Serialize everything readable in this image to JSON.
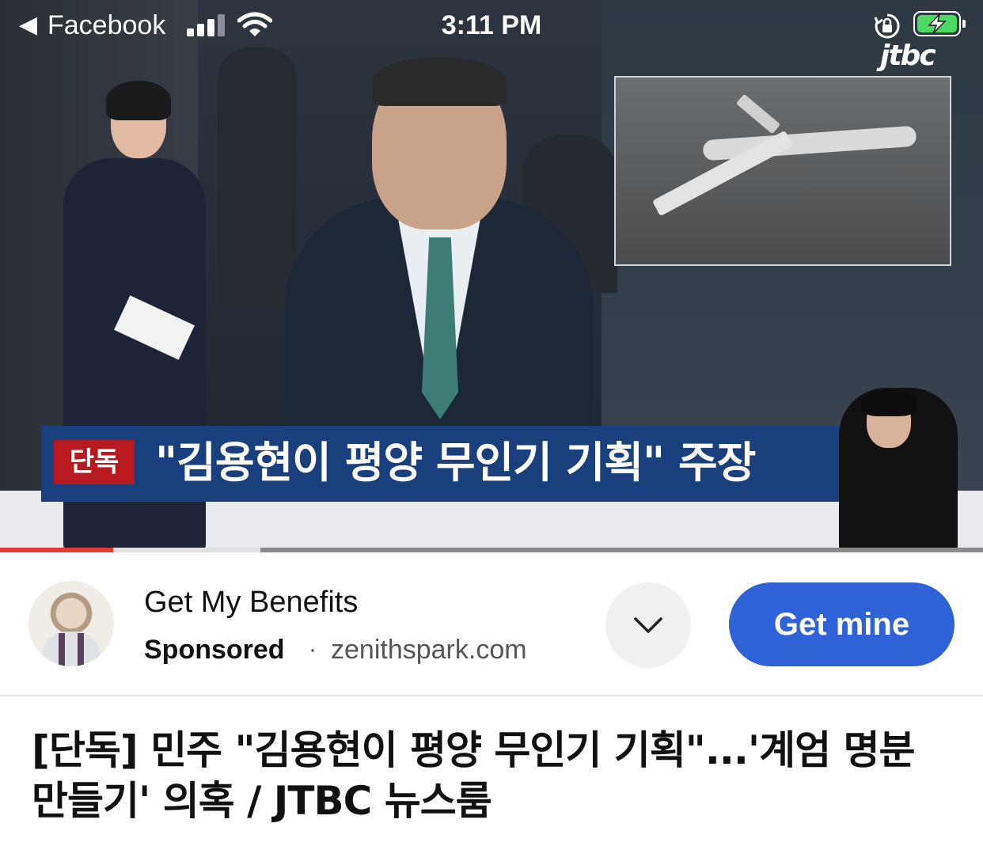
{
  "status_bar": {
    "back_label": "Facebook",
    "time": "3:11 PM",
    "battery_color": "#4cd964"
  },
  "video": {
    "channel_logo": "jtbc",
    "caption_badge": "단독",
    "caption_text": "\"김용현이 평양 무인기 기획\" 주장",
    "progress_played_fraction": 0.115,
    "progress_buffered_fraction": 0.265
  },
  "ad": {
    "advertiser_name": "Get My Benefits",
    "sponsored_label": "Sponsored",
    "separator": "·",
    "domain": "zenithspark.com",
    "cta_label": "Get mine",
    "cta_color": "#2e62d6"
  },
  "post": {
    "title": "[단독] 민주 \"김용현이 평양 무인기 기획\"...'계엄 명분 만들기' 의혹 / JTBC 뉴스룸"
  }
}
